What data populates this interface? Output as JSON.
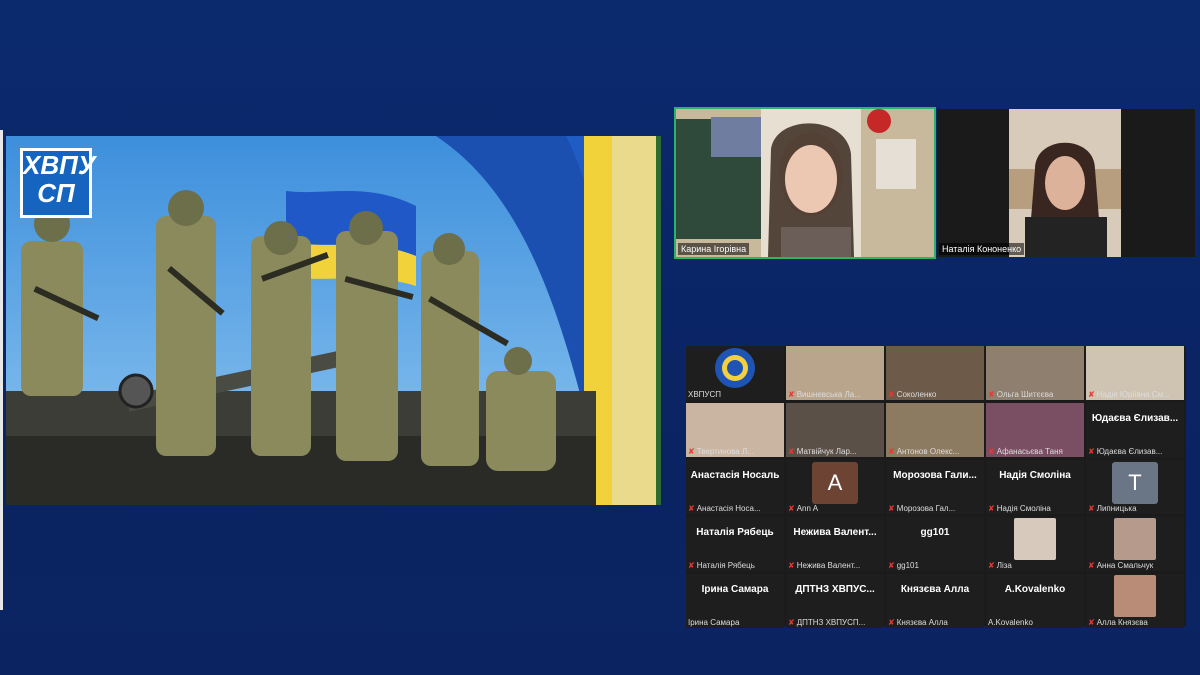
{
  "shared_screen": {
    "logo_line1": "ХВПУ",
    "logo_line2": "СП"
  },
  "speakers": [
    {
      "name": "Карина Ігорівна",
      "active": true
    },
    {
      "name": "Наталія Кононенко",
      "active": false
    }
  ],
  "gallery": {
    "rows": [
      [
        {
          "label": "ХВПУСП",
          "muted": false,
          "kind": "logo"
        },
        {
          "label": "Вишневська Ла...",
          "muted": true,
          "kind": "video",
          "color": "#b9a48c"
        },
        {
          "label": "Соколенко",
          "muted": true,
          "kind": "video",
          "color": "#6d5a49"
        },
        {
          "label": "Ольга Шитєєва",
          "muted": true,
          "kind": "video",
          "color": "#8e7f6e"
        },
        {
          "label": "Надія Юріївна См...",
          "muted": true,
          "kind": "video",
          "color": "#cfc3b2"
        }
      ],
      [
        {
          "label": "Твертинова Л...",
          "muted": true,
          "kind": "video",
          "color": "#c9b5a2"
        },
        {
          "label": "Матвійчук Лар...",
          "muted": true,
          "kind": "video",
          "color": "#5b5048"
        },
        {
          "label": "Антонов Олекс...",
          "muted": true,
          "kind": "video",
          "color": "#8c7a61"
        },
        {
          "label": "Афанасьєва Таня",
          "muted": true,
          "kind": "video",
          "color": "#7a4f63"
        },
        {
          "label": "Юдаєва Єлизав...",
          "muted": true,
          "kind": "name",
          "big": "Юдаєва Єлизав..."
        }
      ],
      [
        {
          "label": "Анастасія Носа...",
          "muted": true,
          "kind": "name",
          "big": "Анастасія Носаль"
        },
        {
          "label": "Аnn A",
          "muted": true,
          "kind": "letter",
          "letter": "A",
          "color": "#6d4334"
        },
        {
          "label": "Морозова Гал...",
          "muted": true,
          "kind": "name",
          "big": "Морозова Гали..."
        },
        {
          "label": "Надія Смоліна",
          "muted": true,
          "kind": "name",
          "big": "Надія Смоліна"
        },
        {
          "label": "Липницька",
          "muted": true,
          "kind": "letter",
          "letter": "T",
          "color": "#6a7686"
        }
      ],
      [
        {
          "label": "Наталія Рябець",
          "muted": true,
          "kind": "name",
          "big": "Наталія Рябець"
        },
        {
          "label": "Нежива Валент...",
          "muted": true,
          "kind": "name",
          "big": "Нежива Валент..."
        },
        {
          "label": "gg101",
          "muted": true,
          "kind": "name",
          "big": "gg101"
        },
        {
          "label": "Ліза",
          "muted": true,
          "kind": "photo",
          "color": "#d8c9bd"
        },
        {
          "label": "Анна Смальчук",
          "muted": true,
          "kind": "photo",
          "color": "#b69a8b"
        }
      ],
      [
        {
          "label": "Ірина Самара",
          "muted": false,
          "kind": "name",
          "big": "Ірина Самара"
        },
        {
          "label": "ДПТНЗ ХВПУСП...",
          "muted": true,
          "kind": "name",
          "big": "ДПТНЗ ХВПУС..."
        },
        {
          "label": "Князєва Алла",
          "muted": true,
          "kind": "name",
          "big": "Князєва Алла"
        },
        {
          "label": "A.Kovalenko",
          "muted": false,
          "kind": "name",
          "big": "A.Kovalenko"
        },
        {
          "label": "Алла Князєва",
          "muted": true,
          "kind": "photo",
          "color": "#b98c78"
        }
      ]
    ]
  }
}
